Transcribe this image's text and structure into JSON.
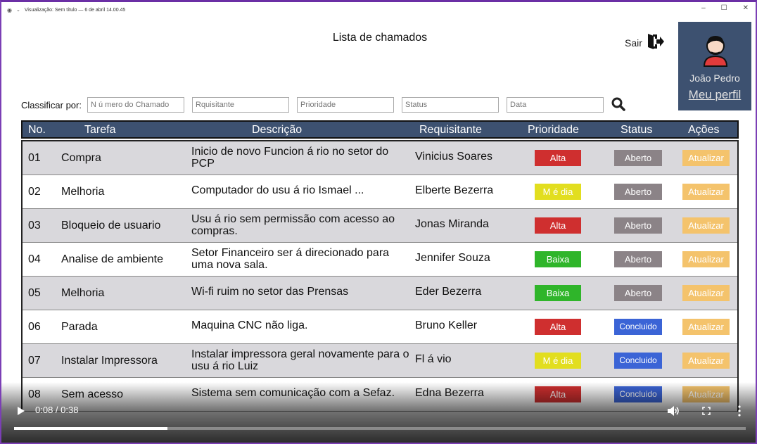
{
  "window": {
    "title": "Visualização: Sem título — 6 de abril 14.00.45"
  },
  "page": {
    "title": "Lista de chamados",
    "logout_label": "Sair"
  },
  "profile": {
    "name": "João Pedro",
    "link": "Meu perfil"
  },
  "filters": {
    "label": "Classificar por:",
    "fields": [
      {
        "placeholder": "N ú mero do Chamado"
      },
      {
        "placeholder": "Rquisitante"
      },
      {
        "placeholder": "Prioridade"
      },
      {
        "placeholder": "Status"
      },
      {
        "placeholder": "Data"
      }
    ]
  },
  "table": {
    "headers": [
      "No.",
      "Tarefa",
      "Descrição",
      "Requisitante",
      "Prioridade",
      "Status",
      "Ações"
    ],
    "rows": [
      {
        "no": "01",
        "task": "Compra",
        "desc": "Inicio de novo Funcion á rio no setor do PCP",
        "req": "Vinicius Soares",
        "prio": "Alta",
        "status": "Aberto",
        "action": "Atualizar"
      },
      {
        "no": "02",
        "task": "Melhoria",
        "desc": "Computador do usu á rio Ismael ...",
        "req": "Elberte Bezerra",
        "prio": "M é dia",
        "status": "Aberto",
        "action": "Atualizar"
      },
      {
        "no": "03",
        "task": "Bloqueio de usuario",
        "desc": "Usu á rio sem permissão com acesso ao compras.",
        "req": "Jonas Miranda",
        "prio": "Alta",
        "status": "Aberto",
        "action": "Atualizar"
      },
      {
        "no": "04",
        "task": "Analise de ambiente",
        "desc": "Setor Financeiro ser á  direcionado para uma nova sala.",
        "req": "Jennifer Souza",
        "prio": "Baixa",
        "status": "Aberto",
        "action": "Atualizar"
      },
      {
        "no": "05",
        "task": "Melhoria",
        "desc": "Wi-fi ruim no setor das Prensas",
        "req": "Eder Bezerra",
        "prio": "Baixa",
        "status": "Aberto",
        "action": "Atualizar"
      },
      {
        "no": "06",
        "task": "Parada",
        "desc": "Maquina CNC não liga.",
        "req": "Bruno Keller",
        "prio": "Alta",
        "status": "Concluido",
        "action": "Atualizar"
      },
      {
        "no": "07",
        "task": "Instalar Impressora",
        "desc": "Instalar impressora geral novamente para o usu á rio Luiz",
        "req": "Fl á vio",
        "prio": "M é dia",
        "status": "Concluido",
        "action": "Atualizar"
      },
      {
        "no": "08",
        "task": "Sem acesso",
        "desc": "Sistema sem comunicação com a Sefaz.",
        "req": "Edna Bezerra",
        "prio": "Alta",
        "status": "Concluido",
        "action": "Atualizar"
      }
    ]
  },
  "colors": {
    "header_bg": "#3d5170",
    "alta": "#cf2f2f",
    "media": "#e2de1f",
    "baixa": "#2fb52a",
    "aberto": "#8b8387",
    "concluido": "#3b64d6",
    "atualizar": "#f4c36c"
  },
  "video": {
    "time": "0:08 / 0:38",
    "progress": 0.21
  }
}
